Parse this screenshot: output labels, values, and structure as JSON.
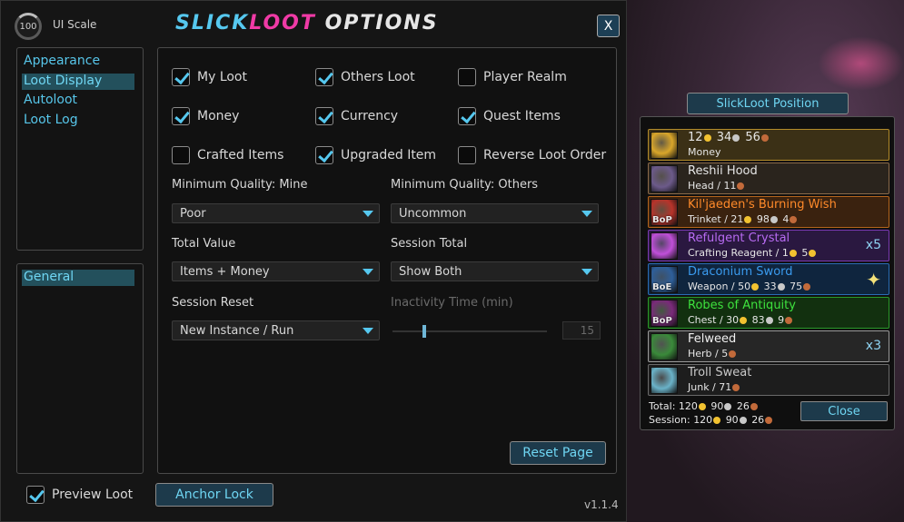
{
  "ui_scale": {
    "value": "100",
    "label": "UI Scale"
  },
  "title": {
    "part1": "SLICK",
    "part2": "LOOT",
    "part3": " OPTIONS"
  },
  "close_label": "X",
  "nav_top": [
    "Appearance",
    "Loot Display",
    "Autoloot",
    "Loot Log"
  ],
  "nav_top_selected": 1,
  "nav_bottom": [
    "General"
  ],
  "checkboxes": [
    {
      "label": "My Loot",
      "checked": true
    },
    {
      "label": "Others Loot",
      "checked": true
    },
    {
      "label": "Player Realm",
      "checked": false
    },
    {
      "label": "Money",
      "checked": true
    },
    {
      "label": "Currency",
      "checked": true
    },
    {
      "label": "Quest Items",
      "checked": true
    },
    {
      "label": "Crafted Items",
      "checked": false
    },
    {
      "label": "Upgraded Item",
      "checked": true
    },
    {
      "label": "Reverse Loot Order",
      "checked": false
    }
  ],
  "settings": {
    "min_quality_mine": {
      "label": "Minimum Quality: Mine",
      "value": "Poor"
    },
    "min_quality_others": {
      "label": "Minimum Quality: Others",
      "value": "Uncommon"
    },
    "total_value": {
      "label": "Total Value",
      "value": "Items + Money"
    },
    "session_total": {
      "label": "Session Total",
      "value": "Show Both"
    },
    "session_reset": {
      "label": "Session Reset",
      "value": "New Instance / Run"
    },
    "inactivity": {
      "label": "Inactivity Time (min)",
      "value": "15"
    }
  },
  "reset_page": "Reset Page",
  "preview_loot": {
    "label": "Preview Loot",
    "checked": true
  },
  "anchor_lock": "Anchor Lock",
  "version": "v1.1.4",
  "loot": {
    "position_button": "SlickLoot Position",
    "items": [
      {
        "name": "",
        "sub": "Money",
        "gold": "12",
        "silver": "34",
        "copper": "56",
        "type": "money",
        "bind": "",
        "qty": "",
        "color": "#e6e6e6",
        "border": "#b38b2a",
        "bg": "#3b3016",
        "icon": "#d9a62a"
      },
      {
        "name": "Reshii Hood",
        "sub": "Head  /  11",
        "type": "item",
        "bind": "",
        "qty": "",
        "color": "#e6e6e6",
        "border": "#8a6a4a",
        "bg": "#2a241d",
        "icon": "#6c5a8a"
      },
      {
        "name": "Kil'jaeden's Burning Wish",
        "sub": "Trinket  /  21",
        "silver": "98",
        "copper": "4",
        "type": "item",
        "bind": "BoP",
        "qty": "",
        "color": "#ff8a2a",
        "border": "#b5651d",
        "bg": "#3a220f",
        "icon": "#b8332a"
      },
      {
        "name": "Refulgent Crystal",
        "sub": "Crafting Reagent  /  1",
        "gold": "5",
        "type": "item",
        "bind": "",
        "qty": "x5",
        "color": "#b86bf2",
        "border": "#7a3ab2",
        "bg": "#2a1840",
        "icon": "#c04fd9"
      },
      {
        "name": "Draconium Sword",
        "sub": "Weapon  /  50",
        "silver": "33",
        "copper": "75",
        "type": "item",
        "bind": "BoE",
        "qty": "",
        "color": "#3a9bef",
        "border": "#2a6db5",
        "bg": "#0f253e",
        "icon": "#2e5f9a"
      },
      {
        "name": "Robes of Antiquity",
        "sub": "Chest  /  30",
        "silver": "83",
        "copper": "9",
        "type": "item",
        "bind": "BoP",
        "qty": "",
        "color": "#3ee23e",
        "border": "#2a9a2a",
        "bg": "#12300f",
        "icon": "#7a2a7a"
      },
      {
        "name": "Felweed",
        "sub": "Herb  /  5",
        "type": "item",
        "bind": "",
        "qty": "x3",
        "color": "#f0f0f0",
        "border": "#9a9a9a",
        "bg": "#262626",
        "icon": "#3a8a3a"
      },
      {
        "name": "Troll Sweat",
        "sub": "Junk  /  71",
        "type": "item",
        "bind": "",
        "qty": "",
        "color": "#c8c8c8",
        "border": "#6a6a6a",
        "bg": "#1d1d1d",
        "icon": "#6ab2c8"
      }
    ],
    "total": {
      "label": "Total:",
      "gold": "120",
      "silver": "90",
      "copper": "26"
    },
    "session": {
      "label": "Session:",
      "gold": "120",
      "silver": "90",
      "copper": "26"
    },
    "close": "Close"
  }
}
